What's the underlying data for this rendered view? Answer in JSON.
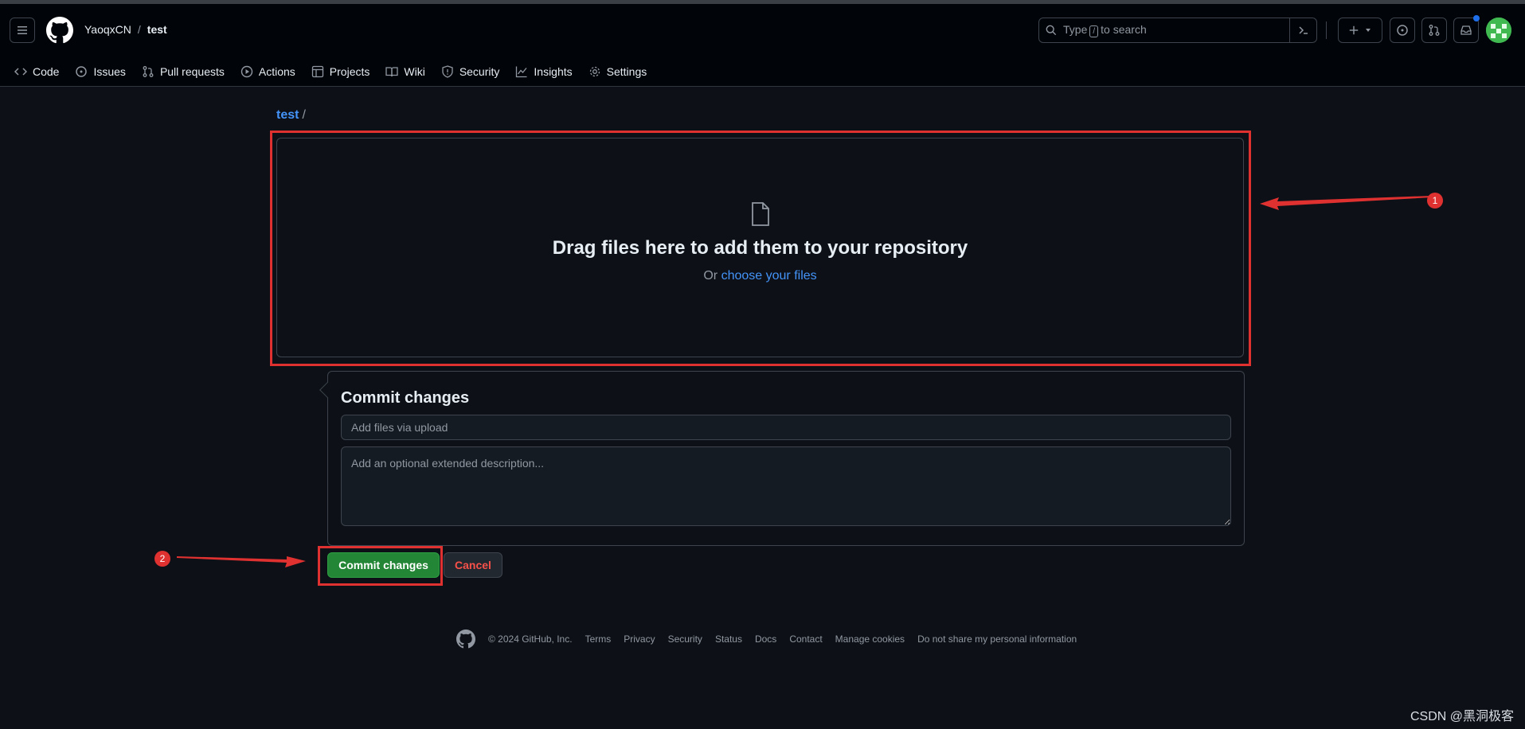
{
  "header": {
    "owner": "YaoqxCN",
    "separator": "/",
    "repo": "test",
    "search_prefix": "Type",
    "search_key": "/",
    "search_suffix": "to search"
  },
  "nav": {
    "tabs": [
      {
        "label": "Code",
        "icon": "code-icon"
      },
      {
        "label": "Issues",
        "icon": "issue-icon"
      },
      {
        "label": "Pull requests",
        "icon": "pull-request-icon"
      },
      {
        "label": "Actions",
        "icon": "play-icon"
      },
      {
        "label": "Projects",
        "icon": "table-icon"
      },
      {
        "label": "Wiki",
        "icon": "book-icon"
      },
      {
        "label": "Security",
        "icon": "shield-icon"
      },
      {
        "label": "Insights",
        "icon": "graph-icon"
      },
      {
        "label": "Settings",
        "icon": "gear-icon"
      }
    ]
  },
  "breadcrumb": {
    "repo_link": "test",
    "separator": "/"
  },
  "dropzone": {
    "title": "Drag files here to add them to your repository",
    "or_text": "Or",
    "choose_link": "choose your files"
  },
  "commit": {
    "heading": "Commit changes",
    "summary_placeholder": "Add files via upload",
    "description_placeholder": "Add an optional extended description...",
    "commit_button": "Commit changes",
    "cancel_button": "Cancel"
  },
  "annotations": {
    "badge_1": "1",
    "badge_2": "2",
    "color": "#e03131"
  },
  "footer": {
    "copyright": "© 2024 GitHub, Inc.",
    "links": [
      "Terms",
      "Privacy",
      "Security",
      "Status",
      "Docs",
      "Contact",
      "Manage cookies",
      "Do not share my personal information"
    ]
  },
  "watermark": "CSDN @黑洞极客",
  "colors": {
    "background": "#0d1117",
    "header": "#010409",
    "link": "#4493f8",
    "primary_button": "#238636",
    "danger_text": "#f85149"
  }
}
